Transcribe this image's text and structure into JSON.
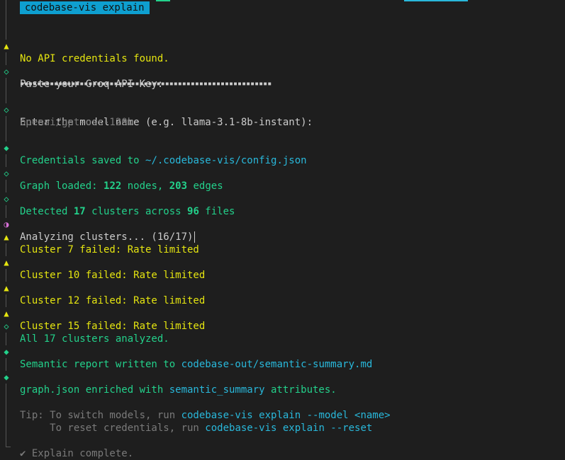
{
  "header": {
    "title": "codebase-vis explain"
  },
  "colors": {
    "background": "#1e1e1e",
    "badge": "#0e9fd0",
    "warning": "#e5e510",
    "success": "#23d18b",
    "path": "#29b8db",
    "spinner": "#d670d6"
  },
  "lines": {
    "no_creds": "No API credentials found.",
    "paste_key_prompt": "Paste your Groq API Key:",
    "paste_key_mask": "▪▪▪▪▪▪▪▪▪▪▪▪▪▪▪▪▪▪▪▪▪▪▪▪▪▪▪▪▪▪▪▪▪▪▪▪▪▪▪▪▪▪▪▪▪▪▪▪▪▪▪▪▪▪▪▪▪▪▪",
    "model_prompt": "Enter the model name (e.g. llama-3.1-8b-instant):",
    "model_value": "openai/gpt-oss-120b",
    "creds_saved_prefix": "Credentials saved to ",
    "creds_saved_path": "~/.codebase-vis/config.json",
    "graph_loaded_prefix": "Graph loaded: ",
    "graph_nodes": "122",
    "graph_nodes_label": " nodes, ",
    "graph_edges": "203",
    "graph_edges_label": " edges",
    "detected_prefix": "Detected ",
    "detected_clusters": "17",
    "detected_mid": " clusters across ",
    "detected_files": "96",
    "detected_suffix": " files",
    "analyzing": "Analyzing clusters... (16/17)",
    "fail_7": "Cluster 7 failed: Rate limited",
    "fail_10": "Cluster 10 failed: Rate limited",
    "fail_12": "Cluster 12 failed: Rate limited",
    "fail_15": "Cluster 15 failed: Rate limited",
    "all_analyzed": "All 17 clusters analyzed.",
    "report_prefix": "Semantic report written to ",
    "report_path": "codebase-out/semantic-summary.md",
    "enriched_prefix": "graph.json enriched with ",
    "enriched_key": "semantic_summary",
    "enriched_suffix": " attributes.",
    "tip_label": "Tip: To switch models, run ",
    "tip_cmd1": "codebase-vis explain --model <name>",
    "tip_line2": "     To reset credentials, run ",
    "tip_cmd2": "codebase-vis explain --reset",
    "complete": "✔ Explain complete."
  },
  "icons": {
    "warning": "▲",
    "step_hollow": "◇",
    "step_filled": "◆",
    "spinner": "◑"
  }
}
